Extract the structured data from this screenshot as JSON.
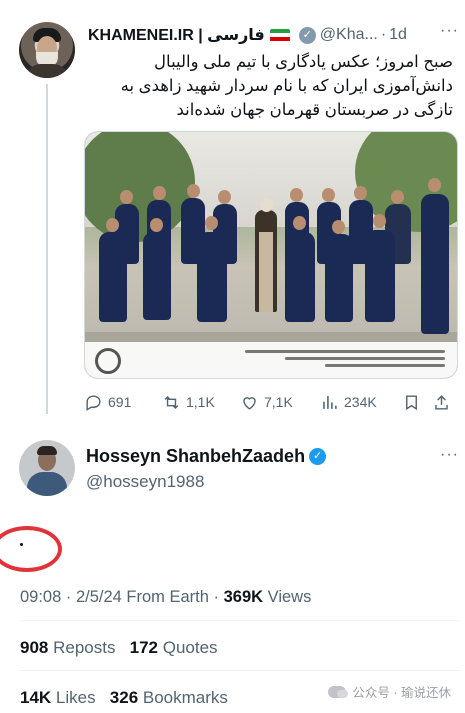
{
  "quoted_tweet": {
    "author_name": "KHAMENEI.IR | فارسی",
    "handle": "@Kha...",
    "separator": "·",
    "time": "1d",
    "verified_glyph": "✓",
    "more_glyph": "···",
    "text": "صبح امروز؛ عکس یادگاری با تیم ملی والیبال دانش‌آموزی ایران که با نام سردار شهید زاهدی به تازگی در صربستان قهرمان جهان شده‌اند",
    "flag_colors": [
      "#239f40",
      "#ffffff",
      "#da0000"
    ],
    "actions": {
      "replies": "691",
      "reposts": "1,1K",
      "likes": "7,1K",
      "views": "234K"
    },
    "icons": [
      "reply-icon",
      "repost-icon",
      "like-icon",
      "views-icon",
      "bookmark-icon",
      "share-icon"
    ]
  },
  "main_tweet": {
    "author_name": "Hosseyn ShanbehZaadeh",
    "handle": "@hosseyn1988",
    "verified_glyph": "✓",
    "more_glyph": "···",
    "text": "·",
    "timestamp": "09:08 · 2/5/24 From Earth · ",
    "views_count": "369K",
    "views_label": " Views",
    "reposts_count": "908",
    "reposts_label": " Reposts",
    "quotes_count": "172",
    "quotes_label": " Quotes",
    "likes_count": "14K",
    "likes_label": " Likes",
    "bookmarks_count": "326",
    "bookmarks_label": " Bookmarks"
  },
  "watermark": {
    "text": "公众号 · 瑜说还休"
  },
  "colors": {
    "verified_gold_grey": "#829aab",
    "verified_blue": "#1d9bf0",
    "annotation_red": "#e0343a",
    "secondary_text": "#536471"
  }
}
